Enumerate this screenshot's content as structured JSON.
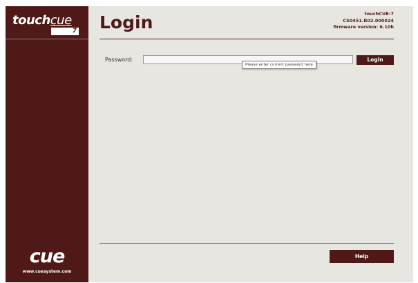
{
  "sidebar": {
    "logo_touch": "touch",
    "logo_cue": "cue",
    "logo_badge": "7",
    "brand": "cue",
    "brand_url": "www.cuesystem.com"
  },
  "header": {
    "title": "Login",
    "device_name": "touchCUE-7",
    "device_code": "CS0451.R02.000024",
    "firmware": "firmware version: 6.10h"
  },
  "login_form": {
    "password_label": "Password:",
    "password_value": "",
    "tooltip": "Please enter current password here",
    "login_button": "Login"
  },
  "footer": {
    "help_button": "Help"
  },
  "colors": {
    "brand": "#4f1917",
    "background": "#e8e6e1"
  }
}
